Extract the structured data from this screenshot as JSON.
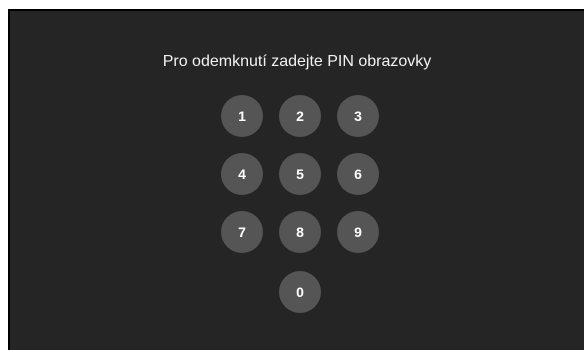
{
  "prompt": "Pro odemknutí zadejte PIN obrazovky",
  "keys": {
    "k1": "1",
    "k2": "2",
    "k3": "3",
    "k4": "4",
    "k5": "5",
    "k6": "6",
    "k7": "7",
    "k8": "8",
    "k9": "9",
    "k0": "0"
  },
  "colors": {
    "background": "#252525",
    "key": "#555555",
    "text": "#f2f2f2"
  }
}
